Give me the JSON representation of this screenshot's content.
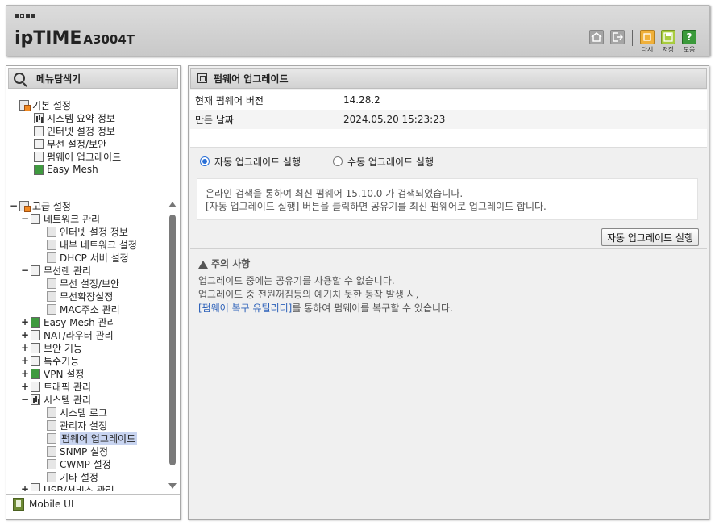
{
  "header": {
    "logo": "ipTIME",
    "model": "A3004T",
    "buttons": [
      {
        "icon": "home-icon"
      },
      {
        "icon": "logout-icon"
      },
      {
        "icon": "refresh-icon",
        "label": "다시"
      },
      {
        "icon": "save-icon",
        "label": "저장"
      },
      {
        "icon": "help-icon",
        "label": "도움"
      }
    ]
  },
  "sidebar": {
    "title": "메뉴탐색기",
    "basic": {
      "label": "기본 설정",
      "items": [
        "시스템 요약 정보",
        "인터넷 설정 정보",
        "무선 설정/보안",
        "펌웨어 업그레이드",
        "Easy Mesh"
      ]
    },
    "advanced": {
      "label": "고급 설정",
      "network": {
        "label": "네트워크 관리",
        "items": [
          "인터넷 설정 정보",
          "내부 네트워크 설정",
          "DHCP 서버 설정"
        ]
      },
      "wireless": {
        "label": "무선랜 관리",
        "items": [
          "무선 설정/보안",
          "무선확장설정",
          "MAC주소 관리"
        ]
      },
      "collapsed": [
        "Easy Mesh 관리",
        "NAT/라우터 관리",
        "보안 기능",
        "특수기능",
        "VPN 설정",
        "트래픽 관리"
      ],
      "system": {
        "label": "시스템 관리",
        "items": [
          "시스템 로그",
          "관리자 설정",
          "펌웨어 업그레이드",
          "SNMP 설정",
          "CWMP 설정",
          "기타 설정"
        ]
      },
      "usb": "USB/서비스 관리"
    },
    "mobile": "Mobile UI"
  },
  "main": {
    "title": "펌웨어 업그레이드",
    "info": [
      {
        "key": "현재 펌웨어 버전",
        "value": "14.28.2"
      },
      {
        "key": "만든 날짜",
        "value": "2024.05.20 15:23:23"
      }
    ],
    "radio_auto": "자동 업그레이드 실행",
    "radio_manual": "수동 업그레이드 실행",
    "message_line1": "온라인 검색을 통하여 최신 펌웨어 15.10.0 가 검색되었습니다.",
    "message_line2": "[자동 업그레이드 실행] 버튼을 클릭하면 공유기를 최신 펌웨어로 업그레이드 합니다.",
    "action_button": "자동 업그레이드 실행",
    "notice_title": "주의 사항",
    "notice_line1": "업그레이드 중에는 공유기를 사용할 수 없습니다.",
    "notice_line2": "업그레이드 중 전원꺼짐등의 예기치 못한 동작 발생 시,",
    "notice_link": "[펌웨어 복구 유틸리티]",
    "notice_line3_rest": "를 통하여 펌웨어를 복구할 수 있습니다."
  }
}
